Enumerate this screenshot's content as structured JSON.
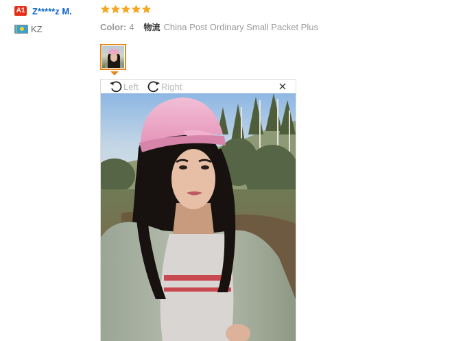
{
  "reviewer": {
    "level_badge": "A1",
    "name": "Z*****z M.",
    "country_code": "KZ",
    "flag_icon": "kazakhstan-flag-icon"
  },
  "review": {
    "rating": 5,
    "rating_max": 5,
    "star_color": "#f5a623",
    "color_label": "Color:",
    "color_value": "4",
    "shipping_label": "物流",
    "shipping_value": "China Post Ordinary Small Packet Plus"
  },
  "thumbnail": {
    "selected": true,
    "accent": "#e8871e"
  },
  "viewer": {
    "rotate_left_label": "Left",
    "rotate_right_label": "Right",
    "rotate_left_icon": "rotate-left-icon",
    "rotate_right_icon": "rotate-right-icon",
    "close_symbol": "×",
    "close_icon": "close-icon"
  },
  "colors": {
    "buyer_name": "#0a63c8",
    "badge_bg": "#e4301a",
    "muted_text": "#999999"
  }
}
